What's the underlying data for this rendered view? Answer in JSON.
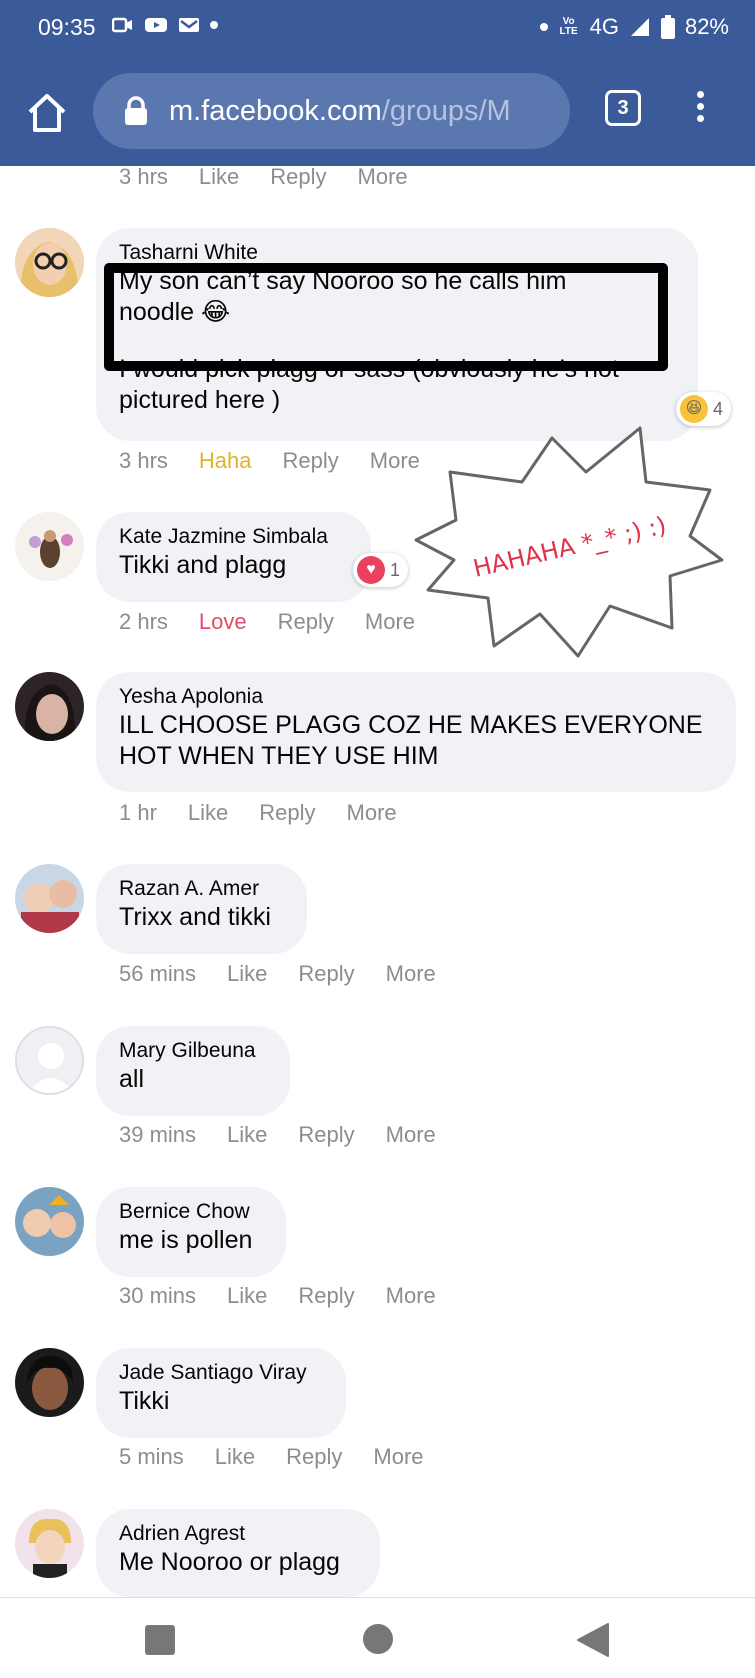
{
  "status_bar": {
    "time": "09:35",
    "network": "4G",
    "volte": "Vo LTE",
    "battery": "82%"
  },
  "browser": {
    "url_host": "m.facebook.com",
    "url_path": "/groups/M",
    "tab_count": "3"
  },
  "top_meta": {
    "time": "3 hrs",
    "like": "Like",
    "reply": "Reply",
    "more": "More"
  },
  "comments": [
    {
      "author": "Tasharni White",
      "text_1": "My son can’t say Nooroo so he calls him",
      "text_2": "noodle 😂",
      "text_3": "I would pick plagg or sass (obviously he’s not",
      "text_4": "pictured here )",
      "reaction_count": "4",
      "time": "3 hrs",
      "like": "Haha",
      "reply": "Reply",
      "more": "More"
    },
    {
      "author": "Kate Jazmine Simbala",
      "text": "Tikki and plagg",
      "reaction_count": "1",
      "time": "2 hrs",
      "like": "Love",
      "reply": "Reply",
      "more": "More"
    },
    {
      "author": "Yesha Apolonia",
      "text_1": "ILL CHOOSE PLAGG COZ HE MAKES EVERYONE",
      "text_2": "HOT WHEN THEY USE HIM",
      "time": "1 hr",
      "like": "Like",
      "reply": "Reply",
      "more": "More"
    },
    {
      "author": "Razan A. Amer",
      "text": "Trixx and tikki",
      "time": "56 mins",
      "like": "Like",
      "reply": "Reply",
      "more": "More"
    },
    {
      "author": "Mary Gilbeuna",
      "text": "all",
      "time": "39 mins",
      "like": "Like",
      "reply": "Reply",
      "more": "More"
    },
    {
      "author": "Bernice Chow",
      "text": "me is pollen",
      "time": "30 mins",
      "like": "Like",
      "reply": "Reply",
      "more": "More"
    },
    {
      "author": "Jade Santiago Viray",
      "text": "Tikki",
      "time": "5 mins",
      "like": "Like",
      "reply": "Reply",
      "more": "More"
    },
    {
      "author": "Adrien Agrest",
      "text": "Me Nooroo or plagg"
    }
  ],
  "sticker": {
    "text": "HAHAHA *_* ;) :)"
  },
  "colors": {
    "brand": "#3b5a9a",
    "haha": "#e2b22a",
    "love": "#e04d6a",
    "bubble": "#f0f2f5",
    "meta": "#8a8d91"
  }
}
